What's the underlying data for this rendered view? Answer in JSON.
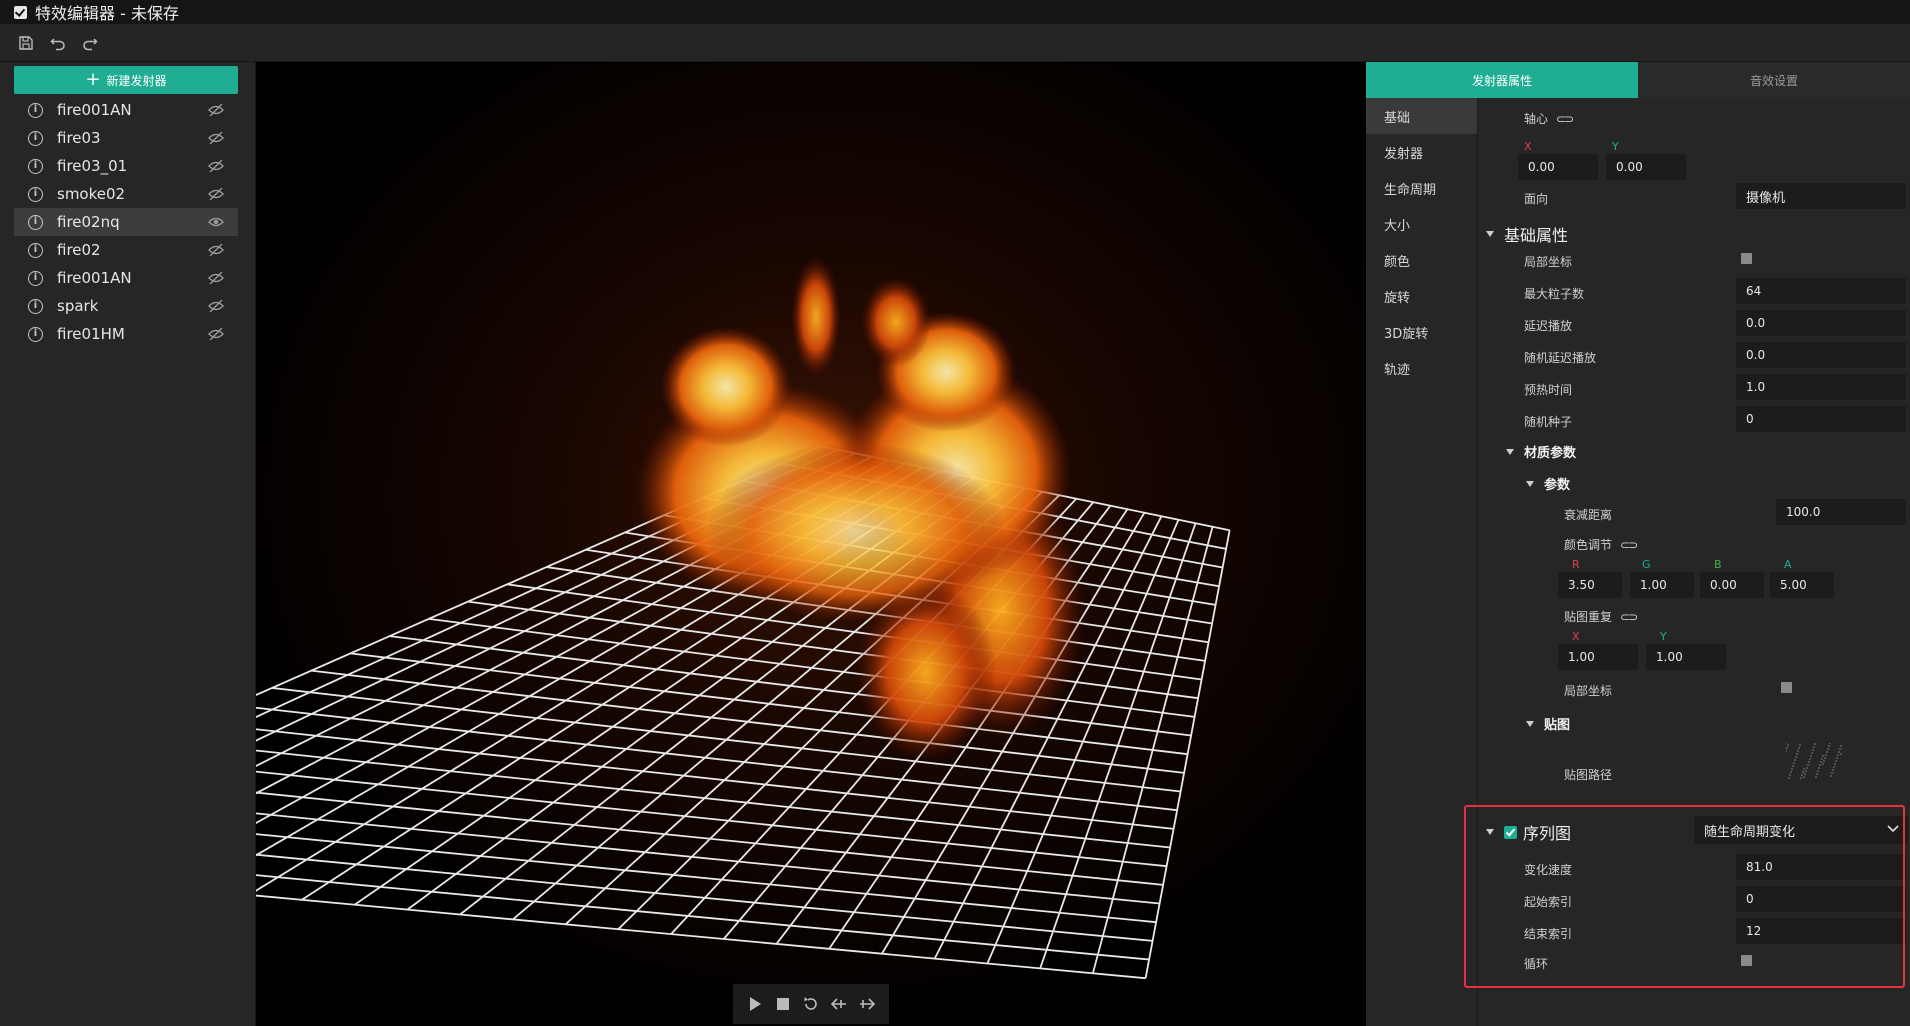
{
  "window": {
    "title": "特效编辑器 - 未保存"
  },
  "toolbar": {
    "icons": [
      "save-icon",
      "undo-icon",
      "redo-icon"
    ]
  },
  "left_panel": {
    "new_emitter_label": "新建发射器",
    "emitters": [
      {
        "name": "fire001AN",
        "visible": false,
        "selected": false
      },
      {
        "name": "fire03",
        "visible": false,
        "selected": false
      },
      {
        "name": "fire03_01",
        "visible": false,
        "selected": false
      },
      {
        "name": "smoke02",
        "visible": false,
        "selected": false
      },
      {
        "name": "fire02nq",
        "visible": true,
        "selected": true
      },
      {
        "name": "fire02",
        "visible": false,
        "selected": false
      },
      {
        "name": "fire001AN",
        "visible": false,
        "selected": false
      },
      {
        "name": "spark",
        "visible": false,
        "selected": false
      },
      {
        "name": "fire01HM",
        "visible": false,
        "selected": false
      }
    ]
  },
  "viewport": {
    "controls": [
      "play-icon",
      "stop-icon",
      "replay-icon",
      "step-back-icon",
      "step-forward-icon"
    ]
  },
  "right_panel": {
    "tabs": [
      {
        "label": "发射器属性",
        "active": true
      },
      {
        "label": "音效设置",
        "active": false
      }
    ],
    "categories": [
      "基础",
      "发射器",
      "生命周期",
      "大小",
      "颜色",
      "旋转",
      "3D旋转",
      "轨迹"
    ],
    "active_category": "基础",
    "pivot": {
      "label": "轴心",
      "x_label": "X",
      "y_label": "Y",
      "x": "0.00",
      "y": "0.00"
    },
    "facing": {
      "label": "面向",
      "value": "摄像机"
    },
    "basic": {
      "header": "基础属性",
      "local_coords_label": "局部坐标",
      "local_coords_checked": false,
      "max_particles_label": "最大粒子数",
      "max_particles": "64",
      "delay_label": "延迟播放",
      "delay": "0.0",
      "random_delay_label": "随机延迟播放",
      "random_delay": "0.0",
      "prewarm_label": "预热时间",
      "prewarm": "1.0",
      "seed_label": "随机种子",
      "seed": "0"
    },
    "material": {
      "header": "材质参数",
      "params_header": "参数",
      "falloff_label": "衰减距离",
      "falloff": "100.0",
      "color_label": "颜色调节",
      "r_label": "R",
      "g_label": "G",
      "b_label": "B",
      "a_label": "A",
      "r": "3.50",
      "g": "1.00",
      "b": "0.00",
      "a": "5.00",
      "tiling_label": "贴图重复",
      "tx_label": "X",
      "ty_label": "Y",
      "tx": "1.00",
      "ty": "1.00",
      "local_label": "局部坐标",
      "local_checked": false,
      "texture_header": "贴图",
      "texture_path_label": "贴图路径"
    },
    "sequence": {
      "header": "序列图",
      "enabled": true,
      "mode": "随生命周期变化",
      "speed_label": "变化速度",
      "speed": "81.0",
      "start_label": "起始索引",
      "start": "0",
      "end_label": "结束索引",
      "end": "12",
      "loop_label": "循环",
      "loop_checked": false
    }
  },
  "colors": {
    "accent": "#1fae93",
    "highlight_border": "#e5303f",
    "axis_x": "#e0404a",
    "axis_y": "#1fae93",
    "axis_b": "#3fb04a"
  }
}
